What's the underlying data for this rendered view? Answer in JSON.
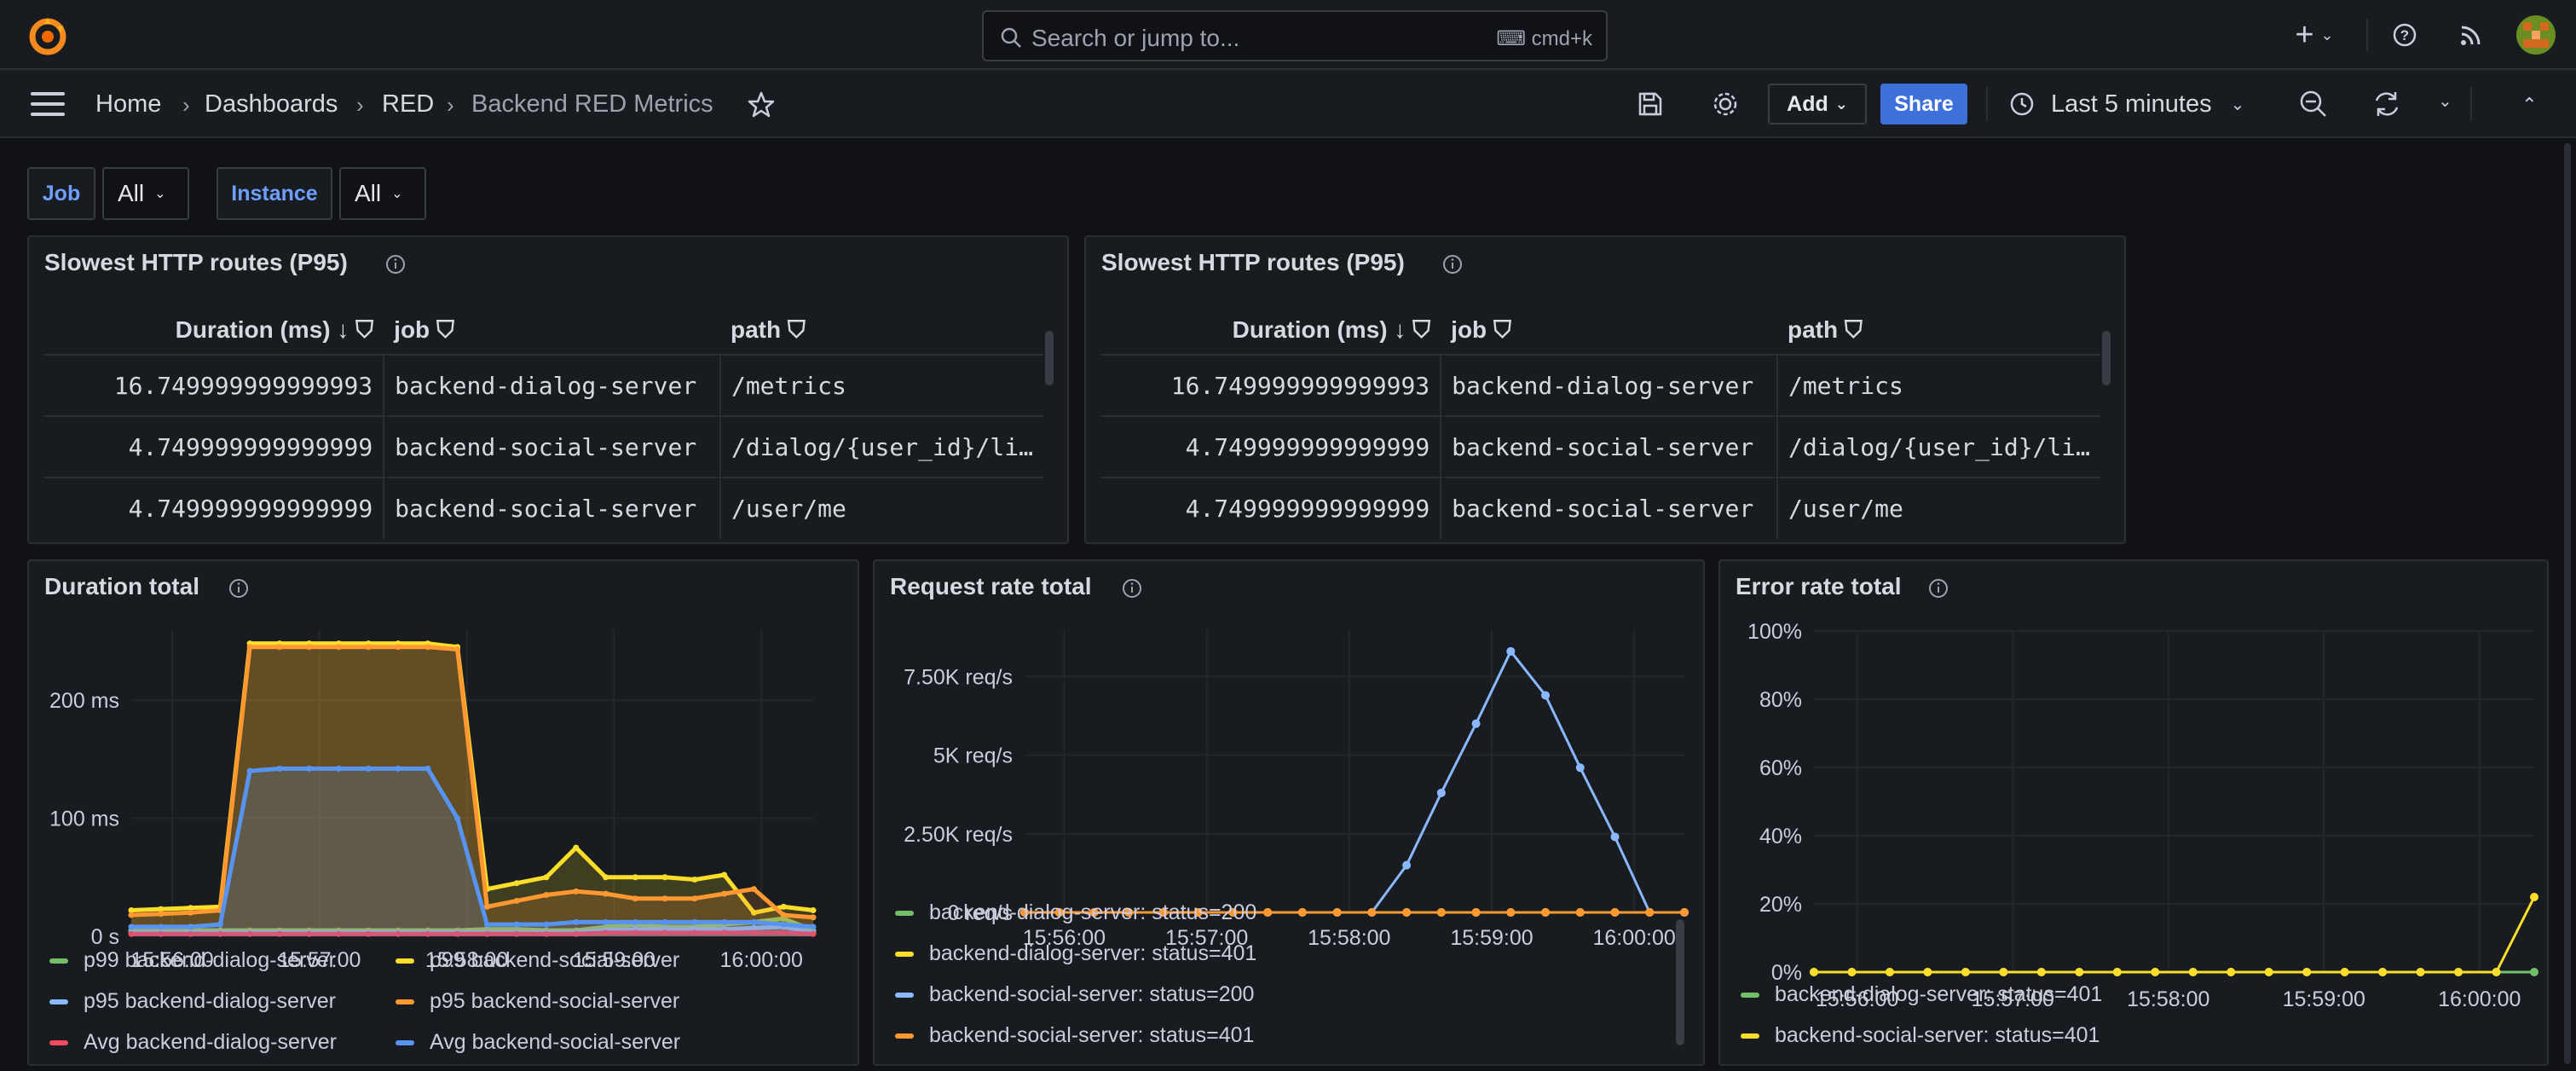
{
  "topbar": {
    "search_placeholder": "Search or jump to...",
    "search_shortcut": "cmd+k",
    "icons": [
      "grafana-logo-icon",
      "search-icon",
      "keyboard-icon",
      "plus-icon",
      "help-icon",
      "rss-icon",
      "avatar"
    ]
  },
  "breadcrumb": {
    "home": "Home",
    "dashboards": "Dashboards",
    "folder": "RED",
    "current": "Backend RED Metrics",
    "separator": "›"
  },
  "toolbar": {
    "add_label": "Add",
    "share_label": "Share",
    "time_range": "Last 5 minutes"
  },
  "variables": [
    {
      "label": "Job",
      "value": "All"
    },
    {
      "label": "Instance",
      "value": "All"
    }
  ],
  "tables": [
    {
      "title": "Slowest HTTP routes (P95)",
      "columns": [
        "Duration (ms)",
        "job",
        "path"
      ],
      "rows": [
        [
          "16.749999999999993",
          "backend-dialog-server",
          "/metrics"
        ],
        [
          "4.749999999999999",
          "backend-social-server",
          "/dialog/{user_id}/li…"
        ],
        [
          "4.749999999999999",
          "backend-social-server",
          "/user/me"
        ]
      ]
    },
    {
      "title": "Slowest HTTP routes (P95)",
      "columns": [
        "Duration (ms)",
        "job",
        "path"
      ],
      "rows": [
        [
          "16.749999999999993",
          "backend-dialog-server",
          "/metrics"
        ],
        [
          "4.749999999999999",
          "backend-social-server",
          "/dialog/{user_id}/li…"
        ],
        [
          "4.749999999999999",
          "backend-social-server",
          "/user/me"
        ]
      ]
    }
  ],
  "colors": {
    "green": "#73bf69",
    "yellow": "#fade2a",
    "blue": "#8ab8ff",
    "orange": "#ff9830",
    "red": "#f2495c",
    "blue2": "#5794f2",
    "accent": "#3d71d9"
  },
  "chart_data": [
    {
      "type": "area",
      "title": "Duration total",
      "x": [
        "15:56:00",
        "15:57:00",
        "15:58:00",
        "15:59:00",
        "16:00:00"
      ],
      "yticks": [
        "0 s",
        "100 ms",
        "200 ms"
      ],
      "ylim": [
        0,
        260
      ],
      "legend_position": "bottom",
      "series": [
        {
          "name": "p99 backend-dialog-server",
          "color": "#73bf69",
          "values": [
            5,
            5,
            5,
            5,
            5,
            5,
            5,
            5,
            5,
            5,
            5,
            5,
            6,
            6,
            5,
            5,
            8,
            10,
            8,
            8,
            10,
            12,
            15,
            5
          ]
        },
        {
          "name": "p99 backend-social-server",
          "color": "#fade2a",
          "values": [
            22,
            23,
            24,
            25,
            248,
            248,
            248,
            248,
            248,
            248,
            248,
            245,
            40,
            45,
            50,
            75,
            50,
            50,
            50,
            48,
            52,
            20,
            25,
            22
          ]
        },
        {
          "name": "p95 backend-dialog-server",
          "color": "#8ab8ff",
          "values": [
            3,
            3,
            3,
            3,
            3,
            3,
            3,
            3,
            3,
            3,
            3,
            3,
            3,
            3,
            3,
            3,
            5,
            6,
            6,
            6,
            6,
            7,
            8,
            3
          ]
        },
        {
          "name": "p95 backend-social-server",
          "color": "#ff9830",
          "values": [
            18,
            19,
            20,
            22,
            245,
            245,
            245,
            245,
            245,
            245,
            245,
            243,
            25,
            30,
            35,
            38,
            36,
            32,
            32,
            32,
            36,
            40,
            18,
            16
          ]
        },
        {
          "name": "Avg backend-dialog-server",
          "color": "#f2495c",
          "values": [
            2,
            2,
            2,
            2,
            2,
            2,
            2,
            2,
            2,
            2,
            2,
            2,
            2,
            2,
            2,
            2,
            3,
            3,
            3,
            3,
            3,
            3,
            3,
            2
          ]
        },
        {
          "name": "Avg backend-social-server",
          "color": "#5794f2",
          "values": [
            8,
            8,
            8,
            10,
            140,
            142,
            142,
            142,
            142,
            142,
            142,
            100,
            10,
            10,
            10,
            12,
            12,
            12,
            12,
            12,
            12,
            12,
            10,
            8
          ]
        }
      ]
    },
    {
      "type": "line",
      "title": "Request rate total",
      "x": [
        "15:56:00",
        "15:57:00",
        "15:58:00",
        "15:59:00",
        "16:00:00"
      ],
      "yticks": [
        "0 req/s",
        "2.50K req/s",
        "5K req/s",
        "7.50K req/s"
      ],
      "ylim": [
        0,
        9000
      ],
      "legend_position": "bottom",
      "series": [
        {
          "name": "backend-dialog-server: status=200",
          "color": "#73bf69",
          "values": [
            0,
            0,
            0,
            0,
            0,
            0,
            0,
            0,
            0,
            0,
            0,
            0,
            0,
            0,
            0,
            0,
            0,
            0,
            0,
            0
          ]
        },
        {
          "name": "backend-dialog-server: status=401",
          "color": "#fade2a",
          "values": [
            0,
            0,
            0,
            0,
            0,
            0,
            0,
            0,
            0,
            0,
            0,
            0,
            0,
            0,
            0,
            0,
            0,
            0,
            0,
            0
          ]
        },
        {
          "name": "backend-social-server: status=200",
          "color": "#8ab8ff",
          "values": [
            0,
            0,
            0,
            0,
            0,
            0,
            0,
            0,
            0,
            0,
            0,
            1500,
            3800,
            6000,
            8300,
            6900,
            4600,
            2400,
            0,
            0
          ]
        },
        {
          "name": "backend-social-server: status=401",
          "color": "#ff9830",
          "values": [
            0,
            0,
            0,
            0,
            0,
            0,
            0,
            0,
            0,
            0,
            0,
            0,
            0,
            0,
            0,
            0,
            0,
            0,
            0,
            0
          ]
        }
      ]
    },
    {
      "type": "line",
      "title": "Error rate total",
      "x": [
        "15:56:00",
        "15:57:00",
        "15:58:00",
        "15:59:00",
        "16:00:00"
      ],
      "yticks": [
        "0%",
        "20%",
        "40%",
        "60%",
        "80%",
        "100%"
      ],
      "ylim": [
        0,
        100
      ],
      "legend_position": "bottom",
      "series": [
        {
          "name": "backend-dialog-server: status=401",
          "color": "#73bf69",
          "values": [
            0,
            0,
            0,
            0,
            0,
            0,
            0,
            0,
            0,
            0,
            0,
            0,
            0,
            0,
            0,
            0,
            0,
            0,
            0,
            0
          ]
        },
        {
          "name": "backend-social-server: status=401",
          "color": "#fade2a",
          "values": [
            0,
            0,
            0,
            0,
            0,
            0,
            0,
            0,
            0,
            0,
            0,
            0,
            0,
            0,
            0,
            0,
            0,
            0,
            0,
            22
          ]
        }
      ]
    }
  ]
}
